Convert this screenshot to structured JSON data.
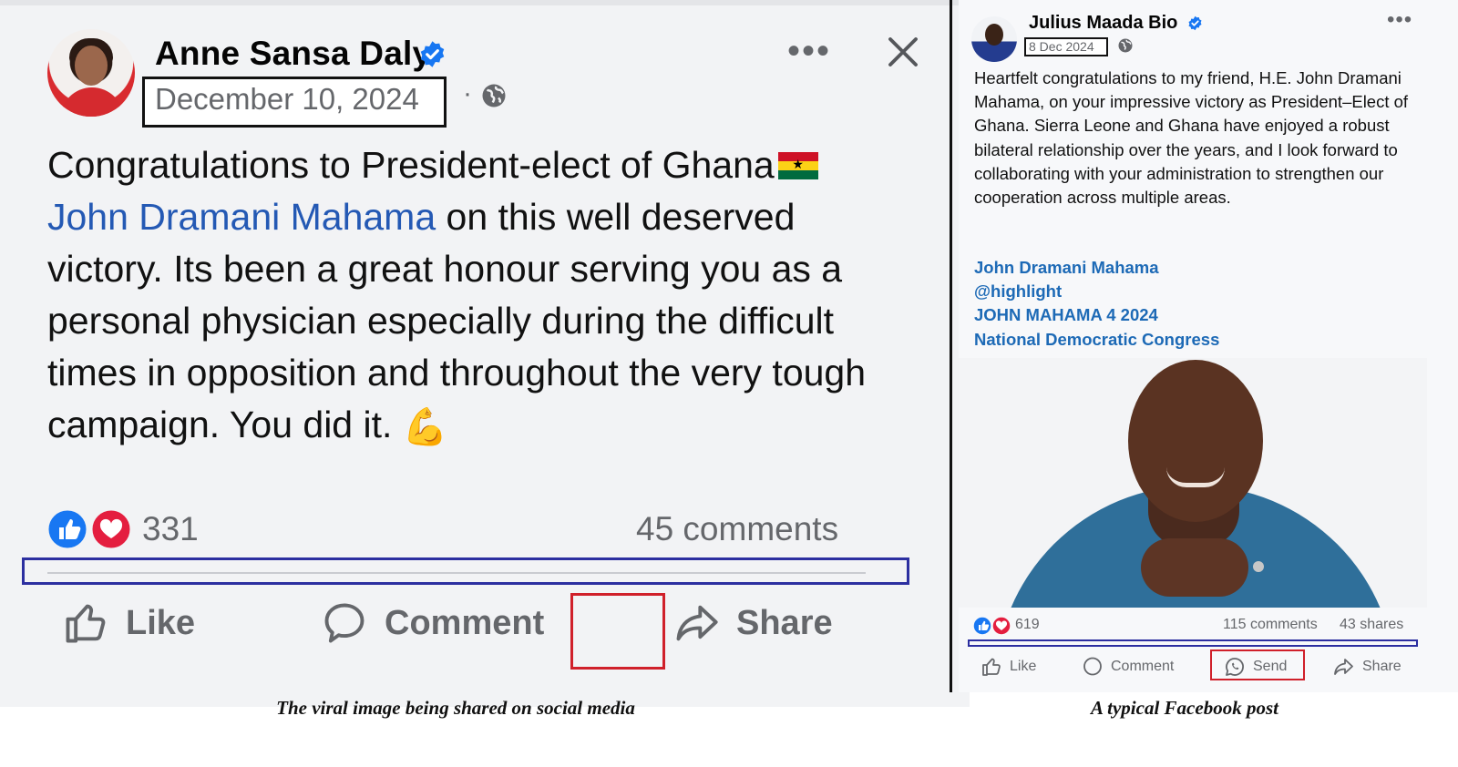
{
  "viral_post": {
    "author": "Anne Sansa Daly",
    "date": "December 10, 2024",
    "text_before_mention": "Congratulations to President-elect of Ghana",
    "mention": "John Dramani Mahama",
    "text_after_mention": " on this well deserved victory. Its been a great honour serving you as a personal physician especially during the difficult times in opposition and throughout the very tough campaign. You did it.",
    "reaction_count": "331",
    "comments": "45 comments",
    "like_label": "Like",
    "comment_label": "Comment",
    "share_label": "Share",
    "caption": "The viral image being shared on social media"
  },
  "typical_post": {
    "author": "Julius Maada Bio",
    "date": "8 Dec 2024",
    "text": "Heartfelt congratulations to my friend, H.E. John Dramani Mahama, on your impressive victory as President–Elect of Ghana. Sierra Leone and Ghana have enjoyed a robust bilateral relationship over the years, and I look forward to collaborating with your administration to strengthen our cooperation across multiple areas.",
    "links": [
      "John Dramani Mahama",
      "@highlight",
      "JOHN MAHAMA 4 2024",
      "National Democratic Congress"
    ],
    "reaction_count": "619",
    "comments": "115 comments",
    "shares": "43 shares",
    "like_label": "Like",
    "comment_label": "Comment",
    "send_label": "Send",
    "share_label": "Share",
    "caption": "A typical Facebook post"
  },
  "colors": {
    "facebook_blue": "#1877f2",
    "mention_blue": "#2459b4",
    "highlight_blue_box": "#2c2fa0",
    "highlight_red_box": "#d0202a",
    "secondary_text": "#65676b"
  }
}
